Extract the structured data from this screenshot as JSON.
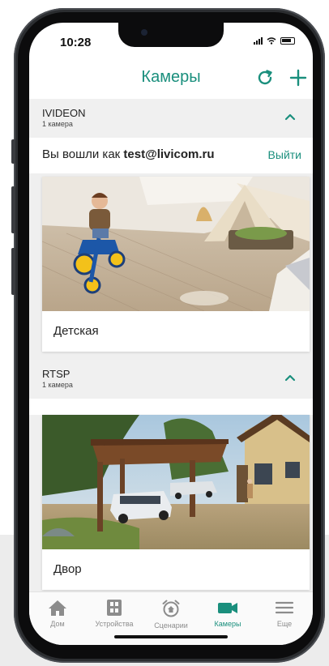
{
  "status_bar": {
    "time": "10:28"
  },
  "header": {
    "title": "Камеры",
    "refresh_icon": "refresh-icon",
    "add_icon": "plus-icon"
  },
  "groups": [
    {
      "title": "IVIDEON",
      "subtitle": "1 камера",
      "login": {
        "prefix": "Вы вошли как ",
        "account": "test@livicom.ru",
        "logout_label": "Выйти"
      },
      "cameras": [
        {
          "name": "Детская"
        }
      ]
    },
    {
      "title": "RTSP",
      "subtitle": "1 камера",
      "cameras": [
        {
          "name": "Двор"
        }
      ]
    }
  ],
  "tabbar": {
    "items": [
      {
        "label": "Дом",
        "icon": "home-icon",
        "active": false
      },
      {
        "label": "Устройства",
        "icon": "devices-icon",
        "active": false
      },
      {
        "label": "Сценарии",
        "icon": "alarm-clock-icon",
        "active": false
      },
      {
        "label": "Камеры",
        "icon": "camera-icon",
        "active": true
      },
      {
        "label": "Еще",
        "icon": "menu-icon",
        "active": false
      }
    ]
  },
  "colors": {
    "accent": "#1a8f7d",
    "inactive": "#8c8c8c",
    "frame": "#2b2d30"
  }
}
